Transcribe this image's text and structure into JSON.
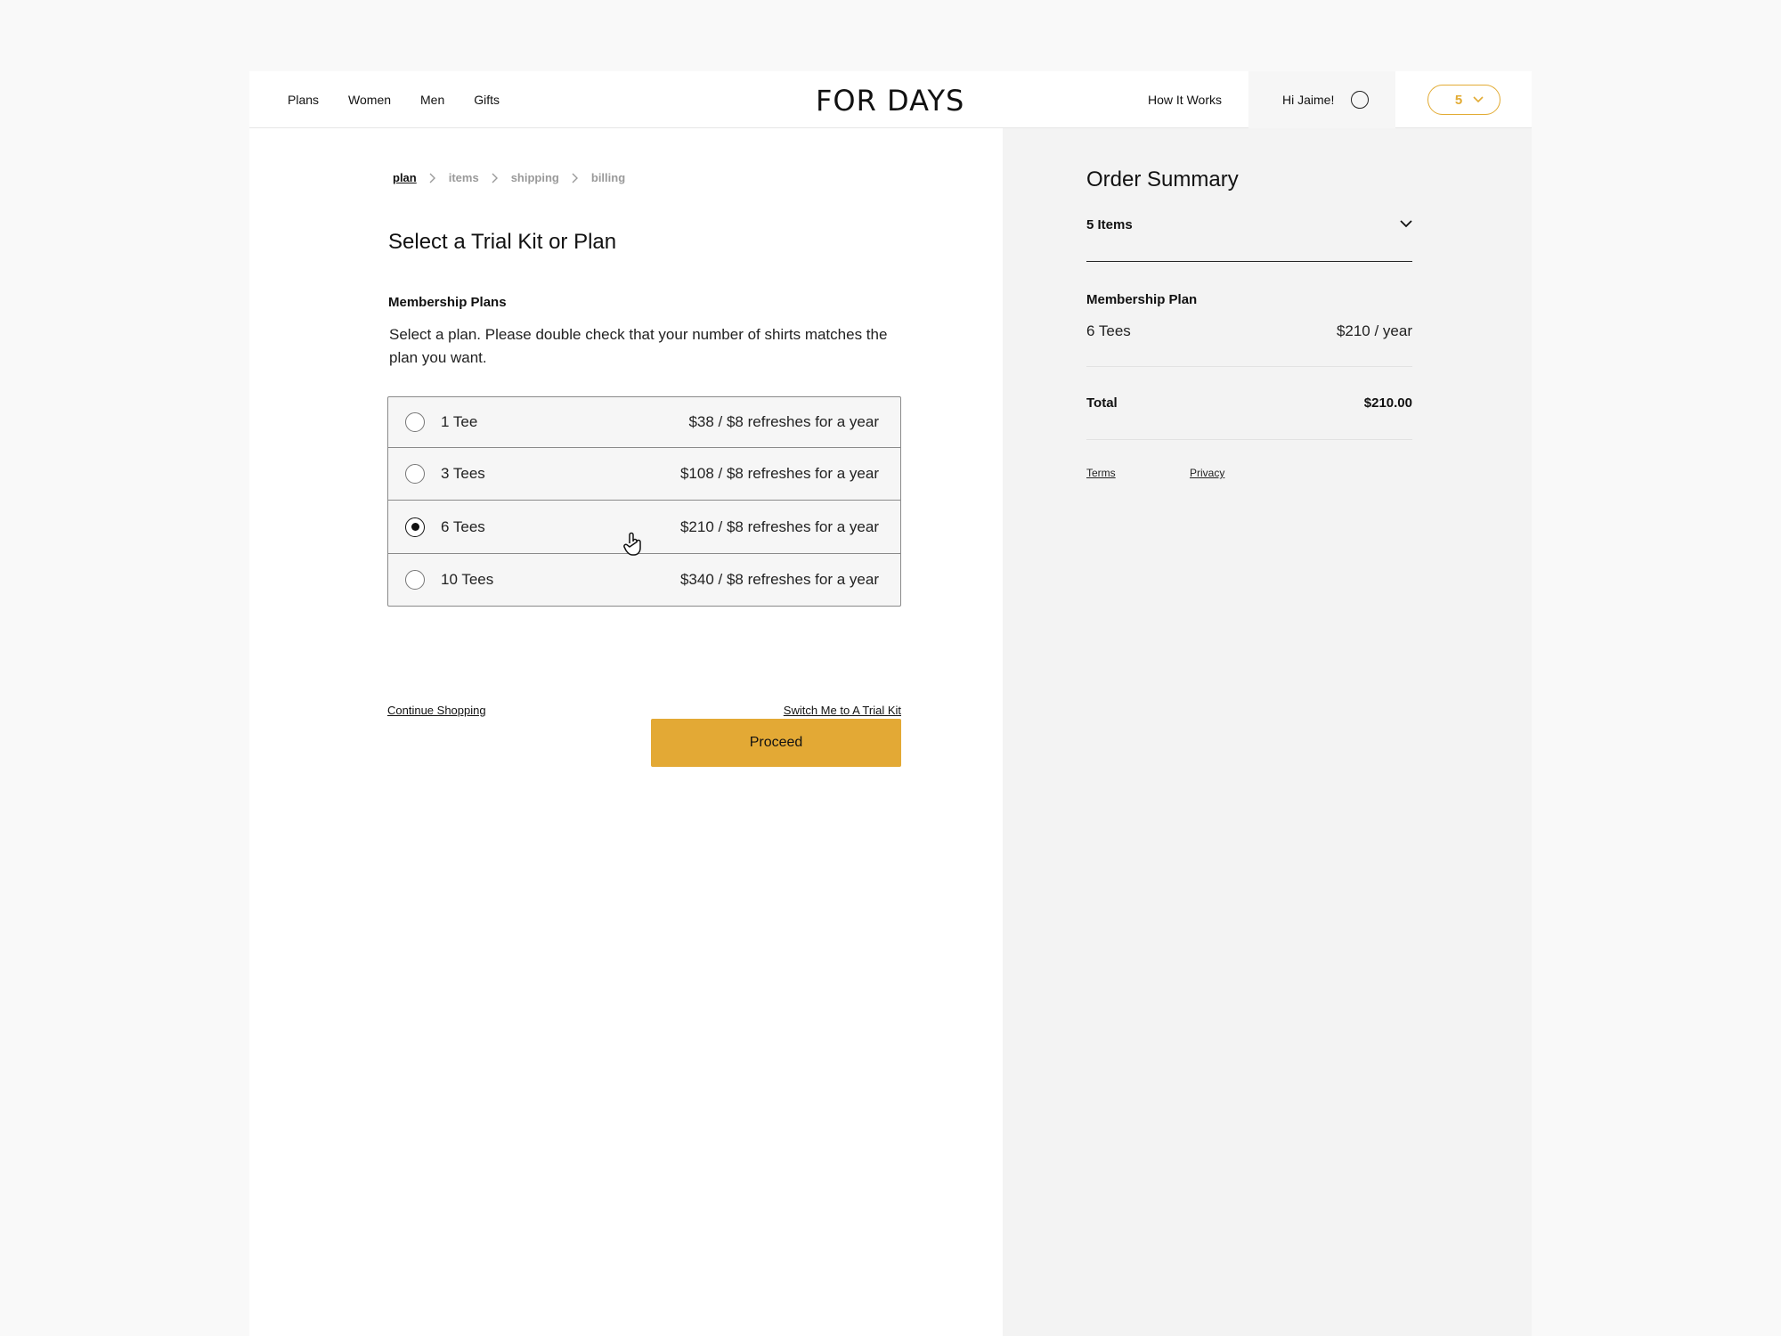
{
  "header": {
    "nav": [
      "Plans",
      "Women",
      "Men",
      "Gifts"
    ],
    "logo": "FOR DAYS",
    "how_it_works": "How It Works",
    "greeting": "Hi Jaime!",
    "cart_count": "5"
  },
  "breadcrumb": [
    "plan",
    "items",
    "shipping",
    "billing"
  ],
  "main": {
    "title": "Select a Trial Kit or Plan",
    "section_title": "Membership Plans",
    "description": "Select a plan. Please double check that your number of shirts matches the plan you want.",
    "plans": [
      {
        "name": "1 Tee",
        "price": "$38 / $8 refreshes for a year",
        "selected": false
      },
      {
        "name": "3 Tees",
        "price": "$108 / $8 refreshes for a year",
        "selected": false
      },
      {
        "name": "6 Tees",
        "price": "$210 / $8 refreshes for a year",
        "selected": true
      },
      {
        "name": "10 Tees",
        "price": "$340 / $8 refreshes for a year",
        "selected": false
      }
    ],
    "continue_shopping": "Continue Shopping",
    "switch_trial": "Switch Me to A Trial Kit",
    "proceed": "Proceed"
  },
  "summary": {
    "title": "Order Summary",
    "items_label": "5 Items",
    "plan_title": "Membership Plan",
    "plan_name": "6 Tees",
    "plan_price": "$210 / year",
    "total_label": "Total",
    "total_value": "$210.00",
    "terms": "Terms",
    "privacy": "Privacy"
  },
  "colors": {
    "accent": "#e3a935",
    "summary_bg": "#f3f3f3"
  }
}
